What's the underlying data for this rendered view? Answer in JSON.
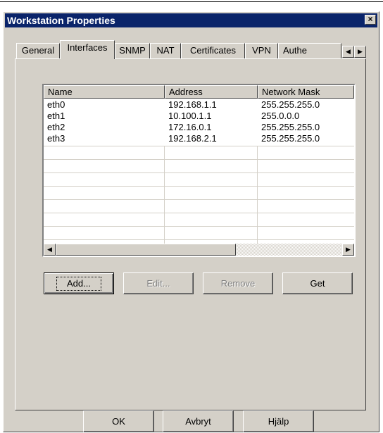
{
  "window": {
    "title": "Workstation Properties",
    "close_glyph": "×"
  },
  "tabs": [
    {
      "label": "General"
    },
    {
      "label": "Interfaces"
    },
    {
      "label": "SNMP"
    },
    {
      "label": "NAT"
    },
    {
      "label": "Certificates"
    },
    {
      "label": "VPN"
    },
    {
      "label": "Authe"
    }
  ],
  "active_tab": "Interfaces",
  "tab_scroll": {
    "left_glyph": "◀",
    "right_glyph": "▶"
  },
  "interfaces": {
    "columns": [
      "Name",
      "Address",
      "Network Mask"
    ],
    "rows": [
      [
        "eth0",
        "192.168.1.1",
        "255.255.255.0"
      ],
      [
        "eth1",
        "10.100.1.1",
        "255.0.0.0"
      ],
      [
        "eth2",
        "172.16.0.1",
        "255.255.255.0"
      ],
      [
        "eth3",
        "192.168.2.1",
        "255.255.255.0"
      ]
    ],
    "scroll_left_glyph": "◀",
    "scroll_right_glyph": "▶"
  },
  "actions": {
    "add": "Add...",
    "edit": "Edit...",
    "remove": "Remove",
    "get": "Get"
  },
  "footer": {
    "ok": "OK",
    "cancel": "Avbryt",
    "help": "Hjälp"
  }
}
